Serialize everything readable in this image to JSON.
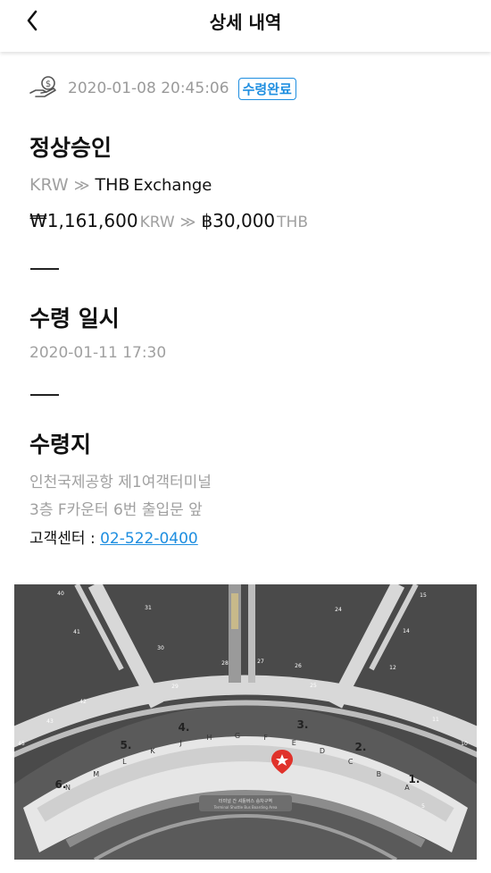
{
  "header": {
    "title": "상세 내역",
    "back_icon": "back-chevron-icon"
  },
  "order": {
    "icon": "money-hand-icon",
    "datetime": "2020-01-08 20:45:06",
    "status_badge": "수령완료",
    "status_color": "#1e8ee0",
    "approval_title": "정상승인",
    "from_currency": "KRW",
    "to_currency": "THB",
    "exchange_word": "Exchange",
    "from_amount": "₩1,161,600",
    "from_amount_unit": "KRW",
    "to_amount": "฿30,000",
    "to_amount_unit": "THB"
  },
  "pickup_time": {
    "title": "수령 일시",
    "value": "2020-01-11 17:30"
  },
  "pickup_place": {
    "title": "수령지",
    "line1": "인천국제공항 제1여객터미널",
    "line2": "3층 F카운터 6번 출입문 앞",
    "contact_label": "고객센터 : ",
    "contact_phone": "02-522-0400"
  },
  "map": {
    "section_numbers": [
      "1.",
      "2.",
      "3.",
      "4.",
      "5.",
      "6."
    ],
    "counters": [
      "A",
      "B",
      "C",
      "D",
      "E",
      "F",
      "G",
      "H",
      "J",
      "K",
      "L",
      "M",
      "N"
    ],
    "gates": [
      "5",
      "10",
      "11",
      "12",
      "14",
      "15",
      "24",
      "25",
      "26",
      "27",
      "28",
      "29",
      "30",
      "31",
      "40",
      "41",
      "42",
      "43",
      "45"
    ],
    "shuttle_label_kr": "터미널 간 셔틀버스 승차구역",
    "shuttle_label_en": "Terminal Shuttle Bus Boarding Area",
    "marker_icon": "location-star-icon"
  }
}
